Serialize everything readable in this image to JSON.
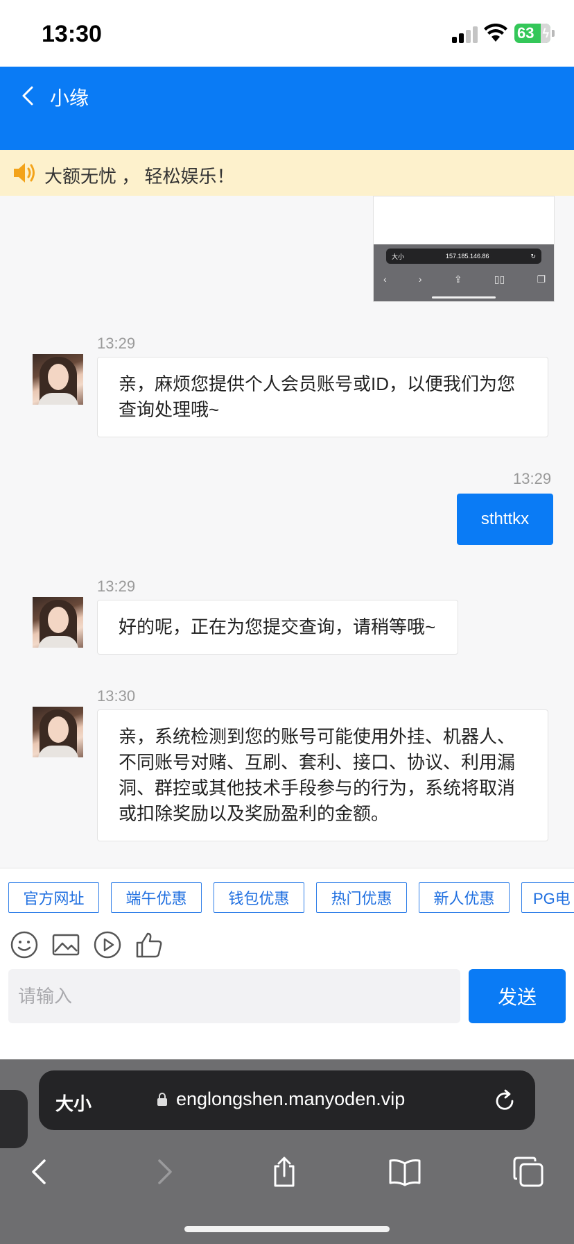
{
  "status_bar": {
    "time": "13:30",
    "battery": "63"
  },
  "header": {
    "title": "小缘"
  },
  "notice": {
    "text": "大额无忧 ， 轻松娱乐！"
  },
  "screenshot_attachment": {
    "size_label": "大小",
    "url": "157.185.146.86"
  },
  "messages": [
    {
      "from": "agent",
      "time": "13:29",
      "text": "亲，麻烦您提供个人会员账号或ID，以便我们为您查询处理哦~"
    },
    {
      "from": "user",
      "time": "13:29",
      "text": "sthttkx"
    },
    {
      "from": "agent",
      "time": "13:29",
      "text": "好的呢，正在为您提交查询，请稍等哦~"
    },
    {
      "from": "agent",
      "time": "13:30",
      "text": "亲，系统检测到您的账号可能使用外挂、机器人、不同账号对赌、互刷、套利、接口、协议、利用漏洞、群控或其他技术手段参与的行为，系统将取消或扣除奖励以及奖励盈利的金额。"
    }
  ],
  "quick_replies": [
    "官方网址",
    "端午优惠",
    "钱包优惠",
    "热门优惠",
    "新人优惠",
    "PG电"
  ],
  "toolbar": {
    "icons": [
      "emoji-icon",
      "image-icon",
      "video-icon",
      "thumbs-up-icon"
    ]
  },
  "input": {
    "placeholder": "请输入",
    "value": ""
  },
  "send": {
    "label": "发送"
  },
  "browser": {
    "size_label": "大小",
    "url": "englongshen.manyoden.vip"
  },
  "colors": {
    "brand_blue": "#0a7bf5",
    "notice_bg": "#fdf1cc",
    "chip_blue": "#2f7ee8"
  }
}
